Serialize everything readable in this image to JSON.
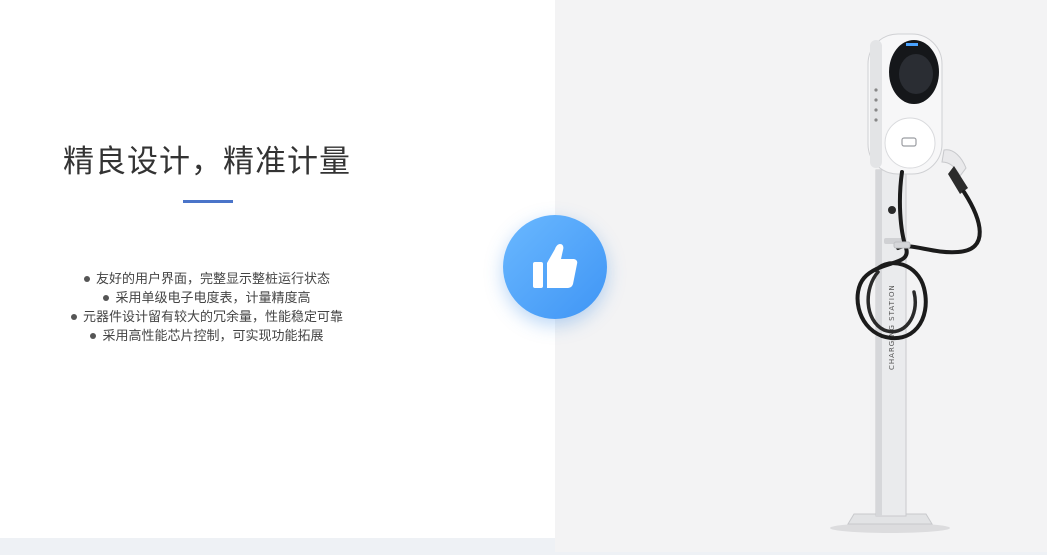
{
  "section": {
    "title": "精良设计，精准计量",
    "features": [
      "友好的用户界面，完整显示整桩运行状态",
      "采用单级电子电度表，计量精度高",
      "元器件设计留有较大的冗余量，性能稳定可靠",
      "采用高性能芯片控制，可实现功能拓展"
    ]
  },
  "badge": {
    "icon": "thumbs-up-icon",
    "color": "#4a9ff7"
  },
  "product": {
    "image": "charging-station-illustration",
    "printed_text": "CHARGING STATION"
  },
  "colors": {
    "accent": "#4a74c9"
  }
}
